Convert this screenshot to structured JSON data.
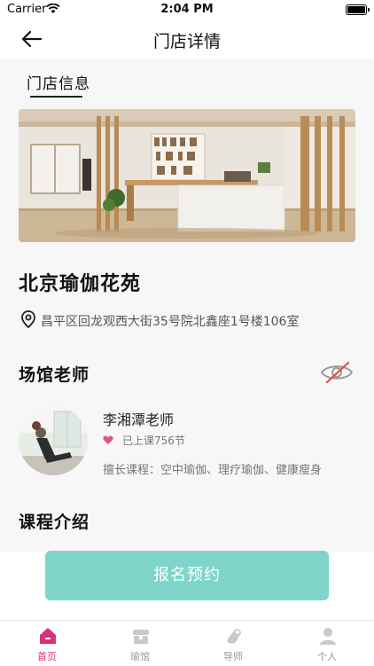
{
  "status_bar": {
    "carrier": "Carrier",
    "time": "2:04 PM"
  },
  "nav": {
    "title": "门店详情",
    "back_icon": "back-arrow-icon"
  },
  "info_tab": {
    "label": "门店信息"
  },
  "store": {
    "name": "北京瑜伽花苑",
    "address": "昌平区回龙观西大街35号院北鑫座1号楼106室",
    "address_icon": "location-pin-icon"
  },
  "teachers_section": {
    "title": "场馆老师",
    "toggle_icon": "eye-slash-icon"
  },
  "teacher": {
    "name": "李湘潭老师",
    "lessons": "已上课756节",
    "specialty": "擅长课程：空中瑜伽、理疗瑜伽、健康瘦身"
  },
  "course_section": {
    "title": "课程介绍"
  },
  "signup_button": {
    "label": "报名预约"
  },
  "tab_bar": {
    "items": [
      {
        "label": "首页",
        "icon": "home-icon",
        "active": true
      },
      {
        "label": "瑜馆",
        "icon": "venue-icon",
        "active": false
      },
      {
        "label": "导师",
        "icon": "tutor-icon",
        "active": false
      },
      {
        "label": "个人",
        "icon": "person-icon",
        "active": false
      }
    ]
  },
  "colors": {
    "accent": "#d6337a",
    "button": "#7fd5c9",
    "heart": "#e0577a"
  }
}
